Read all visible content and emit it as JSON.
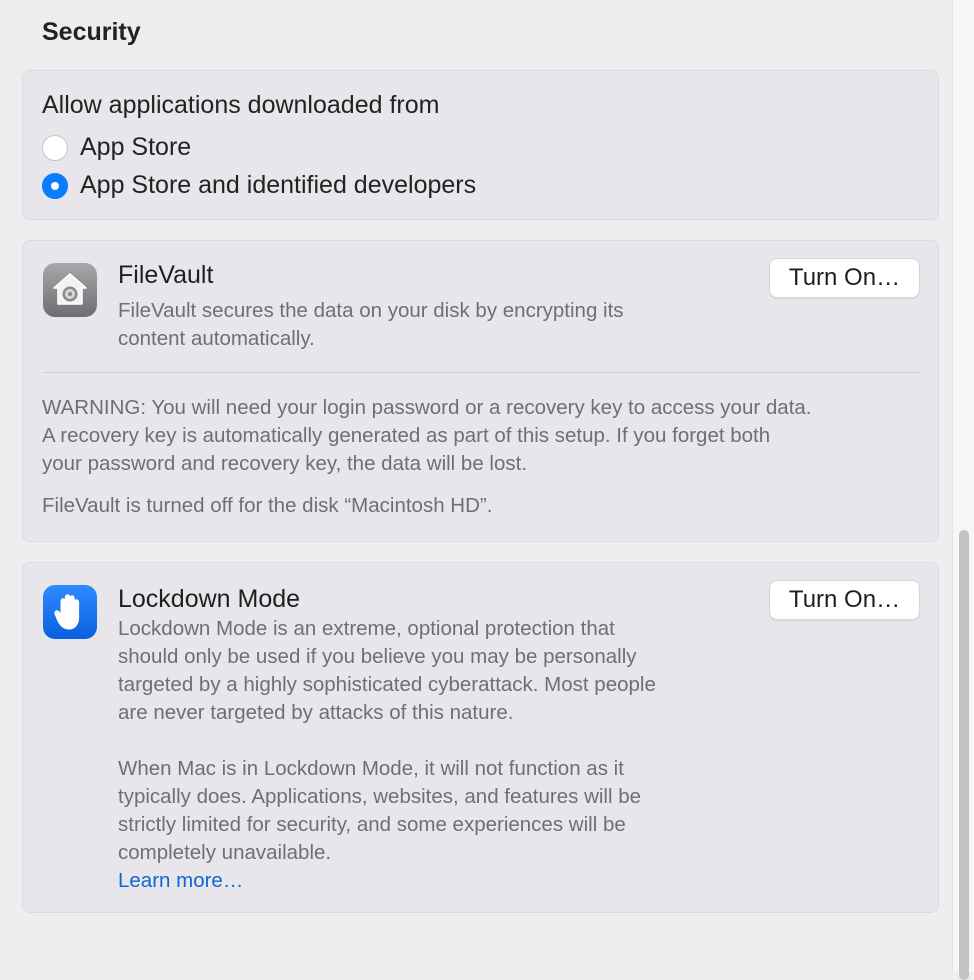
{
  "section": {
    "title": "Security"
  },
  "allow_apps": {
    "title": "Allow applications downloaded from",
    "options": [
      {
        "label": "App Store",
        "selected": false
      },
      {
        "label": "App Store and identified developers",
        "selected": true
      }
    ]
  },
  "filevault": {
    "icon": "filevault-icon",
    "title": "FileVault",
    "description_line1": "FileVault secures the data on your disk by encrypting its",
    "description_line2": "content automatically.",
    "button_label": "Turn On…",
    "warning_line1": "WARNING: You will need your login password or a recovery key to access your data.",
    "warning_line2": "A recovery key is automatically generated as part of this setup. If you forget both",
    "warning_line3": "your password and recovery key, the data will be lost.",
    "status": "FileVault is turned off for the disk “Macintosh HD”."
  },
  "lockdown": {
    "icon": "hand-icon",
    "title": "Lockdown Mode",
    "button_label": "Turn On…",
    "para1_line1": "Lockdown Mode is an extreme, optional protection that",
    "para1_line2": "should only be used if you believe you may be personally",
    "para1_line3": "targeted by a highly sophisticated cyberattack. Most people",
    "para1_line4": "are never targeted by attacks of this nature.",
    "para2_line1": "When Mac is in Lockdown Mode, it will not function as it",
    "para2_line2": "typically does. Applications, websites, and features will be",
    "para2_line3": "strictly limited for security, and some experiences will be",
    "para2_line4": "completely unavailable.",
    "learn_more": "Learn more…"
  },
  "colors": {
    "accent": "#0a7cff",
    "link": "#0a68d6",
    "background": "#efedf0",
    "card": "#e8e6ea"
  }
}
